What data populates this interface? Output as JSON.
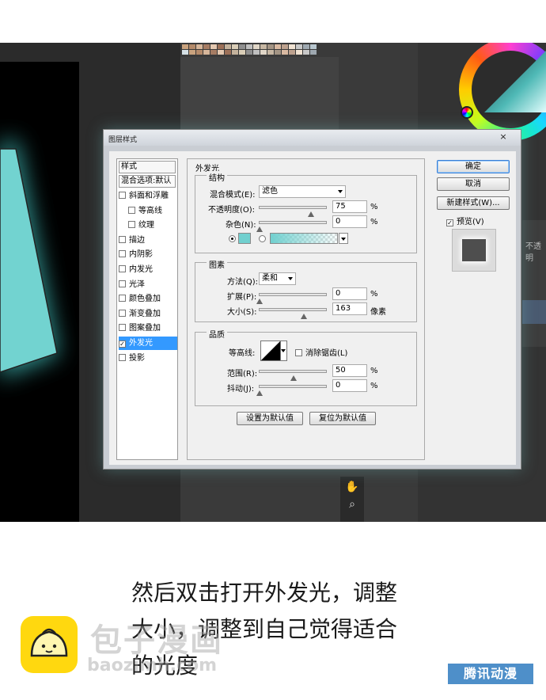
{
  "colors": {
    "glow": "#71d0cf",
    "selection": "#3399ff",
    "logo": "#ffd80f"
  },
  "dialog": {
    "title": "图层样式",
    "close_glyph": "×",
    "style_list": {
      "header": "样式",
      "blend_options": "混合选项:默认",
      "items": [
        {
          "label": "斜面和浮雕",
          "checked": false
        },
        {
          "label": "等高线",
          "checked": false
        },
        {
          "label": "纹理",
          "checked": false
        },
        {
          "label": "描边",
          "checked": false
        },
        {
          "label": "内阴影",
          "checked": false
        },
        {
          "label": "内发光",
          "checked": false
        },
        {
          "label": "光泽",
          "checked": false
        },
        {
          "label": "颜色叠加",
          "checked": false
        },
        {
          "label": "渐变叠加",
          "checked": false
        },
        {
          "label": "图案叠加",
          "checked": false
        },
        {
          "label": "外发光",
          "checked": true,
          "selected": true
        },
        {
          "label": "投影",
          "checked": false
        }
      ]
    },
    "outer_glow": {
      "title": "外发光",
      "structure": {
        "title": "结构",
        "blend_mode_label": "混合模式(E):",
        "blend_mode_value": "滤色",
        "opacity_label": "不透明度(O):",
        "opacity_value": "75",
        "noise_label": "杂色(N):",
        "noise_value": "0",
        "percent": "%"
      },
      "elements": {
        "title": "图素",
        "technique_label": "方法(Q):",
        "technique_value": "柔和",
        "spread_label": "扩展(P):",
        "spread_value": "0",
        "size_label": "大小(S):",
        "size_value": "163",
        "percent": "%",
        "pixels": "像素"
      },
      "quality": {
        "title": "品质",
        "contour_label": "等高线:",
        "antialias_label": "消除锯齿(L)",
        "range_label": "范围(R):",
        "range_value": "50",
        "jitter_label": "抖动(J):",
        "jitter_value": "0",
        "percent": "%"
      },
      "set_default": "设置为默认值",
      "reset_default": "复位为默认值"
    },
    "buttons": {
      "ok": "确定",
      "cancel": "取消",
      "new_style": "新建样式(W)...",
      "preview_label": "预览(V)",
      "preview_checked": true
    }
  },
  "right_panel": {
    "tab_text": "不透明"
  },
  "caption": {
    "line1": "然后双击打开外发光，调整",
    "line2": "大小，调整到自己觉得适合",
    "line3": "的光度"
  },
  "watermark": {
    "text": "包子漫画",
    "url": "baozimh.com"
  },
  "brand": "腾讯动漫"
}
